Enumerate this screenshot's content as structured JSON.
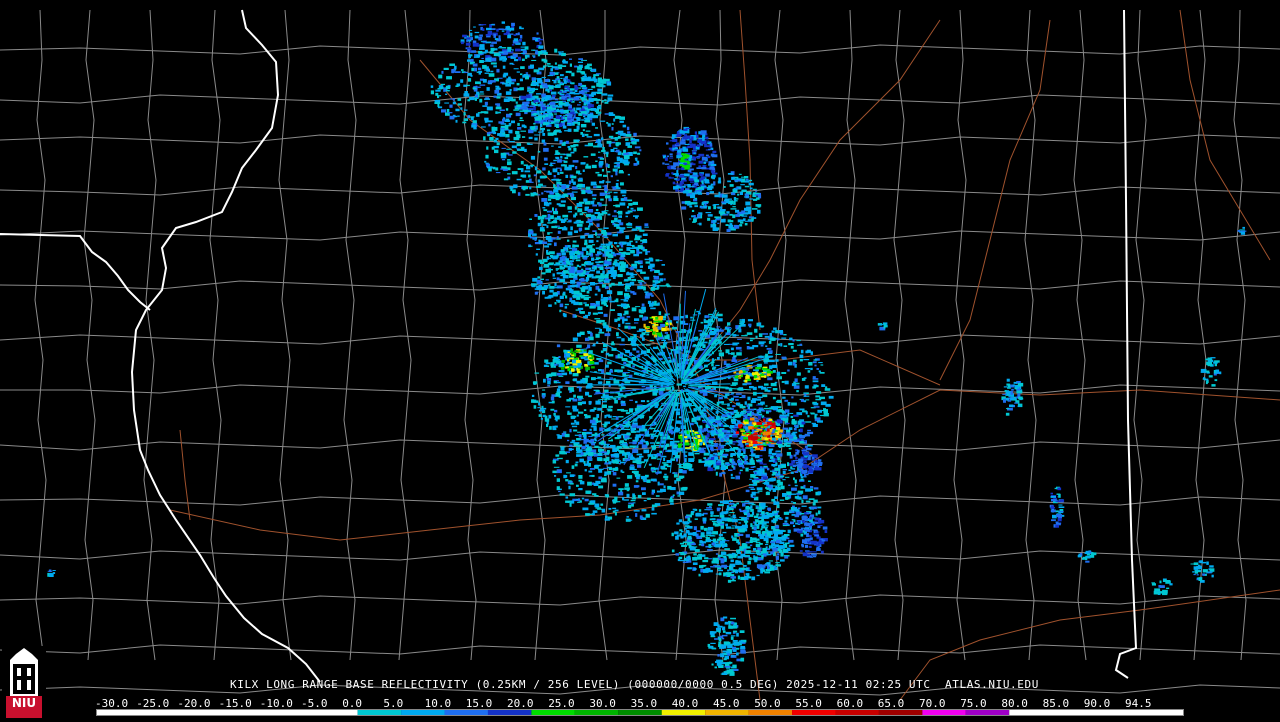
{
  "product": {
    "caption": "KILX LONG RANGE BASE REFLECTIVITY (0.25KM / 256 LEVEL) (000000/0000 0.5 DEG) 2025-12-11 02:25 UTC  ATLAS.NIU.EDU"
  },
  "color_scale": {
    "labels": [
      "-30.0",
      "-25.0",
      "-20.0",
      "-15.0",
      "-10.0",
      "-5.0",
      "0.0",
      "5.0",
      "10.0",
      "15.0",
      "20.0",
      "25.0",
      "30.0",
      "35.0",
      "40.0",
      "45.0",
      "50.0",
      "55.0",
      "60.0",
      "65.0",
      "70.0",
      "75.0",
      "80.0",
      "85.0",
      "90.0",
      "94.5"
    ],
    "colors": {
      "neg": "#ffffff",
      "c0": "#00c8d2",
      "c5": "#00aaf0",
      "c10": "#1e6ef0",
      "c15": "#1432c8",
      "c20": "#00dc00",
      "c25": "#00b400",
      "c30": "#008c00",
      "c35": "#f0f000",
      "c40": "#f0b400",
      "c45": "#f08200",
      "c50": "#f00000",
      "c55": "#c80000",
      "c60": "#a00000",
      "c65": "#f000f0",
      "c70": "#a000c8",
      "c75": "#ffffff"
    }
  },
  "map_colors": {
    "state_border": "#ffffff",
    "county_line": "#8a8a8a",
    "highway": "#a0522d"
  },
  "logo": {
    "text": "NIU",
    "color": "#c8102e"
  }
}
